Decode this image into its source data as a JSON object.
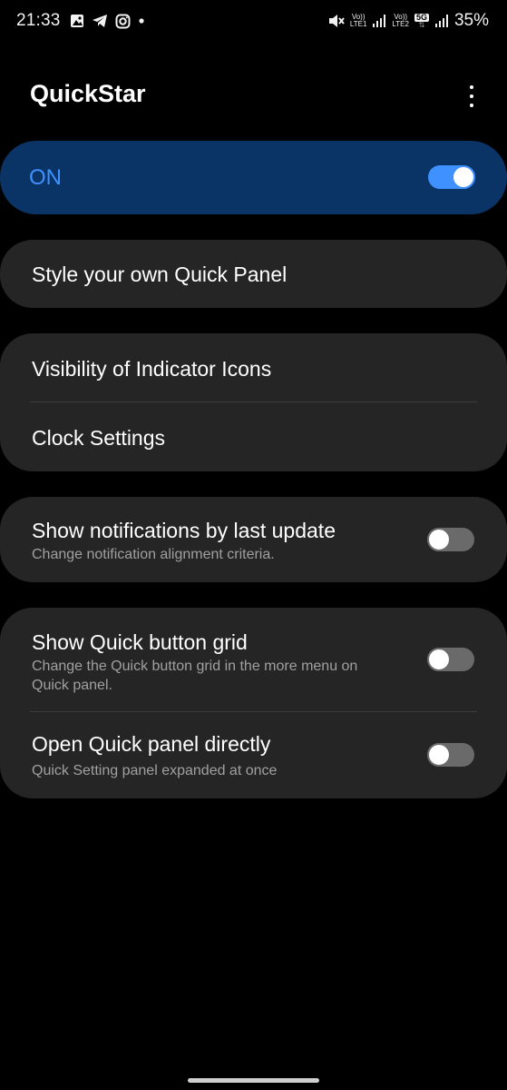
{
  "status_bar": {
    "time": "21:33",
    "sim1_line1": "Vo))",
    "sim1_line2": "LTE1",
    "sim2_line1": "Vo))",
    "sim2_line2": "LTE2",
    "network_type": "5G",
    "battery": "35%"
  },
  "app": {
    "title": "QuickStar"
  },
  "master_switch": {
    "label": "ON",
    "enabled": true
  },
  "cards": {
    "style_panel": {
      "title": "Style your own Quick Panel"
    },
    "indicator": {
      "title": "Visibility of Indicator Icons"
    },
    "clock": {
      "title": "Clock Settings"
    },
    "notifications": {
      "title": "Show notifications by last update",
      "subtitle": "Change notification alignment criteria.",
      "enabled": false
    },
    "button_grid": {
      "title": "Show Quick button grid",
      "subtitle": "Change the Quick button grid in the more menu on Quick panel.",
      "enabled": false
    },
    "open_directly": {
      "title": "Open Quick panel directly",
      "subtitle": "Quick Setting panel expanded at once",
      "enabled": false
    }
  },
  "colors": {
    "background": "#000000",
    "card": "#252525",
    "master_card": "#0b3466",
    "accent": "#3e91ff",
    "toggle_off": "#6a6a6a",
    "subtitle": "#a0a0a0"
  },
  "icons": {
    "gallery": "gallery-icon",
    "telegram": "telegram-icon",
    "instagram": "instagram-icon",
    "mute": "mute-icon",
    "signal": "signal-icon",
    "more": "more-vertical-icon"
  }
}
